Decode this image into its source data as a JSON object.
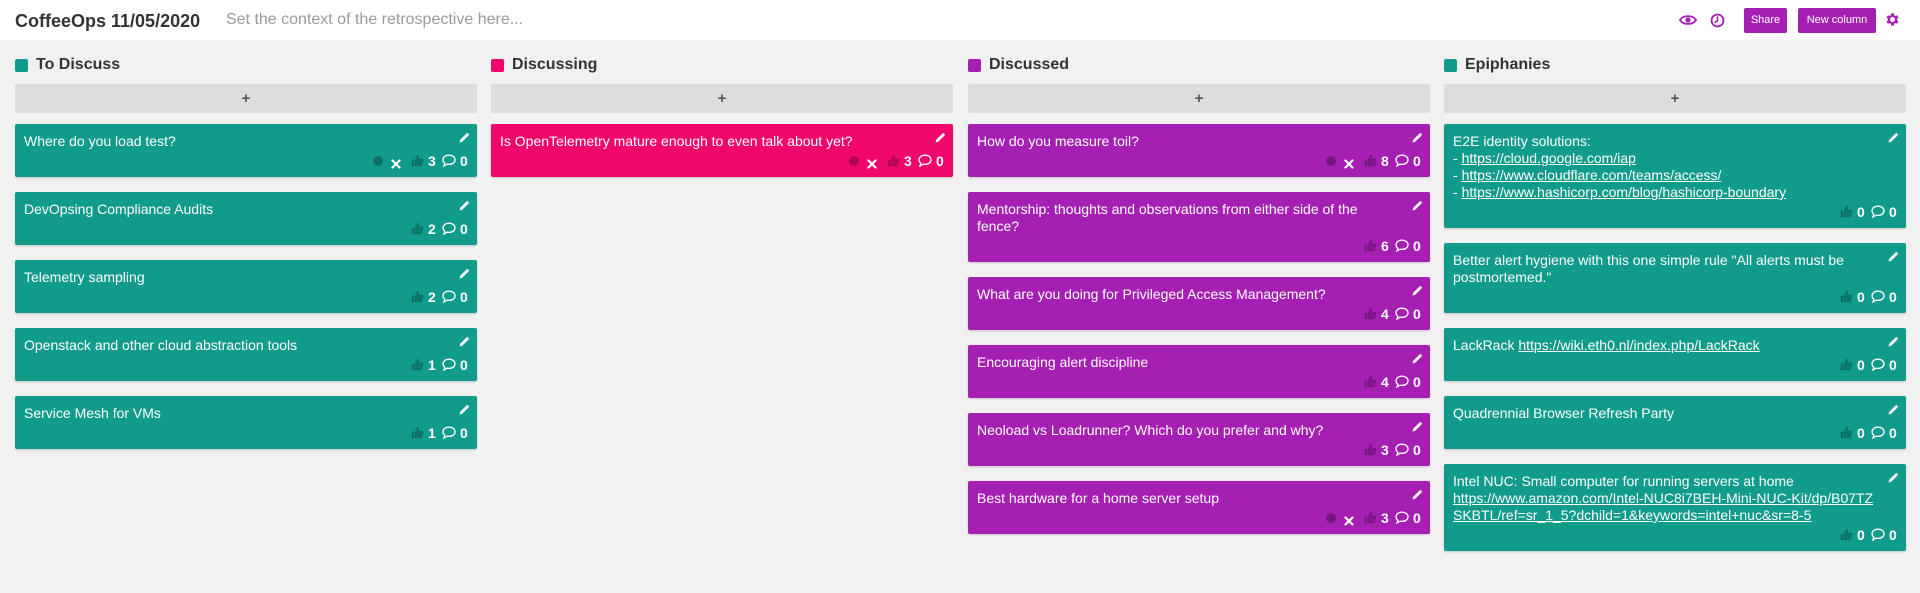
{
  "board": {
    "title": "CoffeeOps 11/05/2020",
    "context_placeholder": "Set the context of the retrospective here...",
    "context_value": ""
  },
  "toolbar": {
    "share_label": "Share",
    "new_column_label": "New column",
    "icons": [
      "eye-icon",
      "clock-icon",
      "gear-icon"
    ],
    "accent_color": "#a51fb2"
  },
  "add_label": "+",
  "columns": [
    {
      "title": "To Discuss",
      "color": "#119b8a",
      "cards": [
        {
          "text": "Where do you load test?",
          "votes": "3",
          "comments": "0",
          "own_vote": true
        },
        {
          "text": "DevOpsing Compliance Audits",
          "votes": "2",
          "comments": "0",
          "own_vote": false
        },
        {
          "text": "Telemetry sampling",
          "votes": "2",
          "comments": "0",
          "own_vote": false
        },
        {
          "text": "Openstack and other cloud abstraction tools",
          "votes": "1",
          "comments": "0",
          "own_vote": false
        },
        {
          "text": "Service Mesh for VMs",
          "votes": "1",
          "comments": "0",
          "own_vote": false
        }
      ]
    },
    {
      "title": "Discussing",
      "color": "#f0076c",
      "cards": [
        {
          "text": "Is OpenTelemetry mature enough to even talk about yet?",
          "votes": "3",
          "comments": "0",
          "own_vote": true
        }
      ]
    },
    {
      "title": "Discussed",
      "color": "#a51fb2",
      "cards": [
        {
          "text": "How do you measure toil?",
          "votes": "8",
          "comments": "0",
          "own_vote": true
        },
        {
          "text": "Mentorship: thoughts and observations from either side of the fence?",
          "votes": "6",
          "comments": "0",
          "own_vote": false
        },
        {
          "text": "What are you doing for Privileged Access Management?",
          "votes": "4",
          "comments": "0",
          "own_vote": false
        },
        {
          "text": "Encouraging alert discipline",
          "votes": "4",
          "comments": "0",
          "own_vote": false
        },
        {
          "text": "Neoload vs Loadrunner? Which do you prefer and why?",
          "votes": "3",
          "comments": "0",
          "own_vote": false
        },
        {
          "text": "Best hardware for a home server setup",
          "votes": "3",
          "comments": "0",
          "own_vote": true
        }
      ]
    },
    {
      "title": "Epiphanies",
      "color": "#119b8a",
      "cards": [
        {
          "text": "E2E identity solutions:",
          "links": [
            "https://cloud.google.com/iap",
            "https://www.cloudflare.com/teams/access/",
            "https://www.hashicorp.com/blog/hashicorp-boundary"
          ],
          "votes": "0",
          "comments": "0",
          "own_vote": false
        },
        {
          "text": "Better alert hygiene with this one simple rule \"All alerts must be postmortemed.\"",
          "votes": "0",
          "comments": "0",
          "own_vote": false
        },
        {
          "text": "LackRack",
          "inline_link": "https://wiki.eth0.nl/index.php/LackRack",
          "votes": "0",
          "comments": "0",
          "own_vote": false
        },
        {
          "text": "Quadrennial Browser Refresh Party",
          "votes": "0",
          "comments": "0",
          "own_vote": false
        },
        {
          "text": "Intel NUC: Small computer for running servers at home",
          "url_block": "https://www.amazon.com/Intel-NUC8i7BEH-Mini-NUC-Kit/dp/B07TZSKBTL/ref=sr_1_5?dchild=1&keywords=intel+nuc&sr=8-5",
          "votes": "0",
          "comments": "0",
          "own_vote": false
        }
      ]
    }
  ]
}
